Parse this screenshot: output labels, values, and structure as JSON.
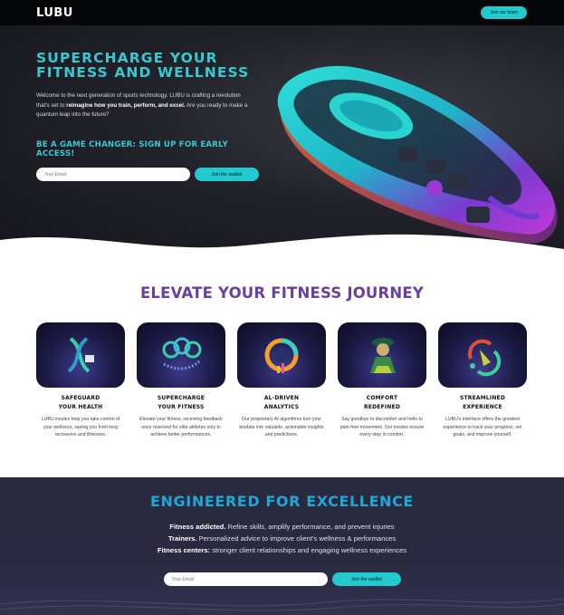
{
  "nav": {
    "logo": "LUBU",
    "team_button": "Join our team"
  },
  "hero": {
    "title": "SUPERCHARGE YOUR FITNESS AND WELLNESS",
    "intro_prefix": "Welcome to the next generation of sports technology. LUBU is crafting a revolution that's set to ",
    "intro_bold": "reimagine how you train, perform, and excel.",
    "intro_suffix": " Are you ready to make a quantum leap into the future?",
    "signup_heading": "BE A GAME CHANGER: SIGN UP FOR EARLY ACCESS!",
    "email_placeholder": "Your Email",
    "waitlist_button": "Join the waitlist",
    "insole_image": "smart-insole-illustration"
  },
  "elevate": {
    "title": "ELEVATE YOUR FITNESS JOURNEY",
    "cards": [
      {
        "icon": "dna-health-icon",
        "title_l1": "SAFEGUARD",
        "title_l2": "YOUR HEALTH",
        "text": "LUBU insoles help you take control of your wellness, saving you from long recoveries and illnesses."
      },
      {
        "icon": "olympic-rings-icon",
        "title_l1": "SUPERCHARGE",
        "title_l2": "YOUR FITNESS",
        "text": "Elevate your fitness, receiving feedback once reserved for elite athletes only to achieve better performances."
      },
      {
        "icon": "ai-analytics-icon",
        "title_l1": "AL-DRIVEN",
        "title_l2": "ANALYTICS",
        "text": "Our proprietary AI algorithms turn your biodata into valuable, actionable insights and predictions."
      },
      {
        "icon": "comfort-person-icon",
        "title_l1": "COMFORT",
        "title_l2": "REDEFINED",
        "text": "Say goodbye to discomfort and hello to pain-free movement. Our insoles ensure every step in comfort."
      },
      {
        "icon": "streamlined-cycle-icon",
        "title_l1": "STREAMLINED",
        "title_l2": "EXPERIENCE",
        "text": "LUBU's interface offers the greatest experience to track your progress, set goals, and improve yourself."
      }
    ]
  },
  "engineered": {
    "title": "ENGINEERED FOR EXCELLENCE",
    "line1_bold": "Fitness addicted.",
    "line1_rest": " Refine skills, amplify performance, and prevent injuries",
    "line2_bold": "Trainers.",
    "line2_rest": " Personalized advice to improve client's wellness & performances",
    "line3_bold": "Fitness centers:",
    "line3_rest": " stronger client relationships and engaging wellness experiences",
    "email_placeholder": "Your Email",
    "waitlist_button": "Join the waitlist"
  },
  "colors": {
    "accent_teal": "#22c9cf",
    "heading_purple": "#6b3fa0",
    "heading_blue": "#1fa7d8",
    "dark_bg": "#15161c"
  }
}
